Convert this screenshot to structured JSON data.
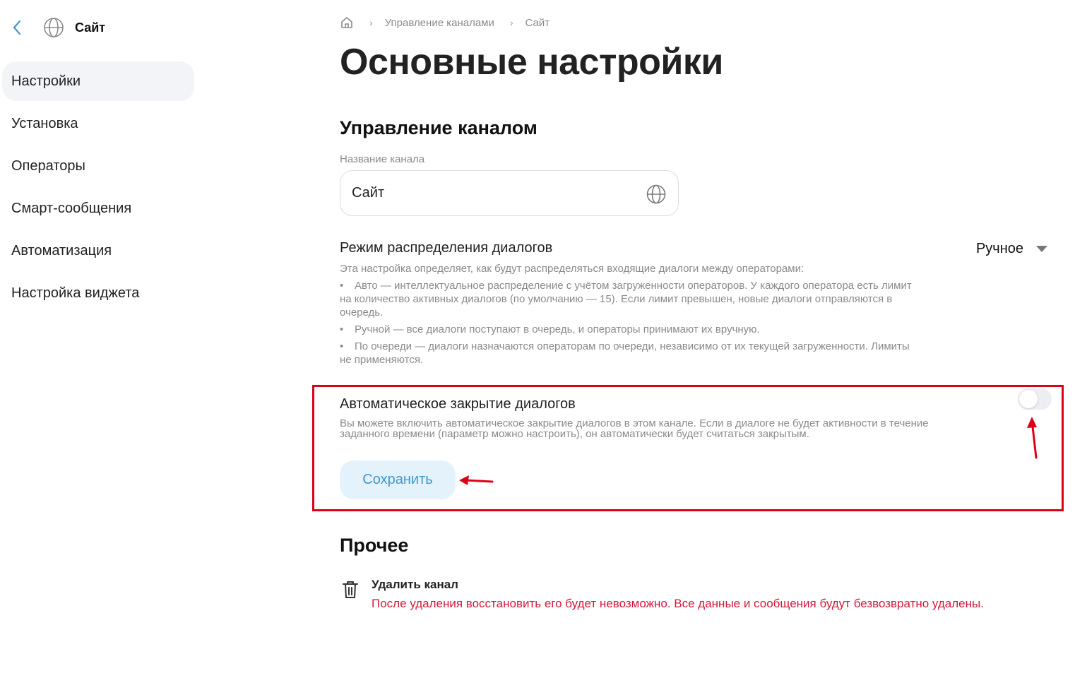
{
  "sidebar": {
    "title": "Сайт",
    "items": [
      {
        "label": "Настройки"
      },
      {
        "label": "Установка"
      },
      {
        "label": "Операторы"
      },
      {
        "label": "Смарт-сообщения"
      },
      {
        "label": "Автоматизация"
      },
      {
        "label": "Настройка виджета"
      }
    ],
    "active_index": 0
  },
  "breadcrumb": {
    "items": [
      "Управление каналами",
      "Сайт"
    ]
  },
  "page_title": "Основные настройки",
  "channel_section": {
    "title": "Управление каналом",
    "name_label": "Название канала",
    "name_value": "Сайт",
    "distribution": {
      "title": "Режим распределения диалогов",
      "selected": "Ручное",
      "intro": "Эта настройка определяет, как будут распределяться входящие диалоги между операторами:",
      "bullets": [
        "Авто — интеллектуальное распределение с учётом загруженности операторов. У каждого оператора есть лимит на количество активных диалогов (по умолчанию — 15). Если лимит превышен, новые диалоги отправляются в очередь.",
        "Ручной — все диалоги поступают в очередь, и операторы принимают их вручную.",
        "По очереди — диалоги назначаются операторам по очереди, независимо от их текущей загруженности. Лимиты не применяются."
      ]
    },
    "auto_close": {
      "title": "Автоматическое закрытие диалогов",
      "description": "Вы можете включить автоматическое закрытие диалогов в этом канале. Если в диалоге не будет активности в течение заданного времени (параметр можно настроить), он автоматически будет считаться закрытым.",
      "enabled": false
    },
    "save_label": "Сохранить"
  },
  "other_section": {
    "title": "Прочее",
    "delete_title": "Удалить канал",
    "delete_warning": "После удаления восстановить его будет невозможно. Все данные и сообщения будут безвозвратно удалены."
  },
  "colors": {
    "accent": "#3f97d2",
    "save_bg": "#e3f2fb",
    "danger": "#d6173a",
    "annotation": "#e00016",
    "muted": "#8a8a8a"
  },
  "icons": [
    "back-arrow-icon",
    "globe-icon",
    "home-icon",
    "chevron-right-icon",
    "chevron-down-icon",
    "trash-icon"
  ]
}
